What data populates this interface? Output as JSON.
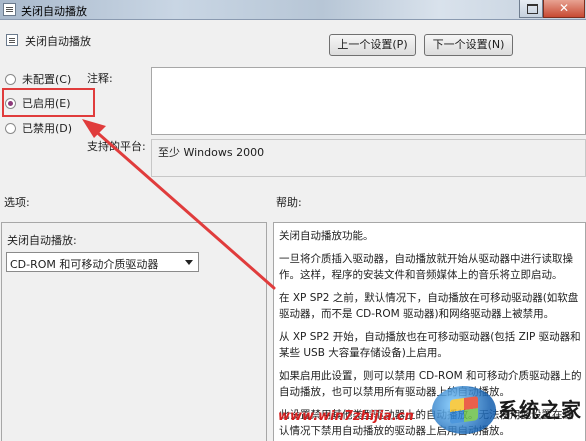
{
  "window": {
    "title": "关闭自动播放"
  },
  "header": {
    "title": "关闭自动播放",
    "prev_button": "上一个设置(P)",
    "next_button": "下一个设置(N)"
  },
  "state": {
    "options": [
      {
        "label": "未配置(C)",
        "checked": false
      },
      {
        "label": "已启用(E)",
        "checked": true
      },
      {
        "label": "已禁用(D)",
        "checked": false
      }
    ]
  },
  "comment": {
    "label": "注释:",
    "value": ""
  },
  "platform": {
    "label": "支持的平台:",
    "value": "至少 Windows 2000"
  },
  "options_section": {
    "heading": "选项:",
    "field_label": "关闭自动播放:",
    "selected": "CD-ROM 和可移动介质驱动器"
  },
  "help": {
    "heading": "帮助:",
    "paragraphs": [
      "关闭自动播放功能。",
      "一旦将介质插入驱动器，自动播放就开始从驱动器中进行读取操作。这样，程序的安装文件和音频媒体上的音乐将立即启动。",
      "在 XP SP2 之前，默认情况下，自动播放在可移动驱动器(如软盘驱动器，而不是 CD-ROM 驱动器)和网络驱动器上被禁用。",
      "从 XP SP2 开始，自动播放也在可移动驱动器(包括 ZIP 驱动器和某些 USB 大容量存储设备)上启用。",
      "如果启用此设置，则可以禁用 CD-ROM 和可移动介质驱动器上的自动播放，也可以禁用所有驱动器上的自动播放。",
      "此设置禁用其他类型驱动器上的自动播放。无法使用此设置在默认情况下禁用自动播放的驱动器上启用自动播放。"
    ]
  },
  "watermark": {
    "brand": "系统之家",
    "url": "www.win7zhijia.cn"
  },
  "annotation": {
    "color": "#e03c3c"
  }
}
